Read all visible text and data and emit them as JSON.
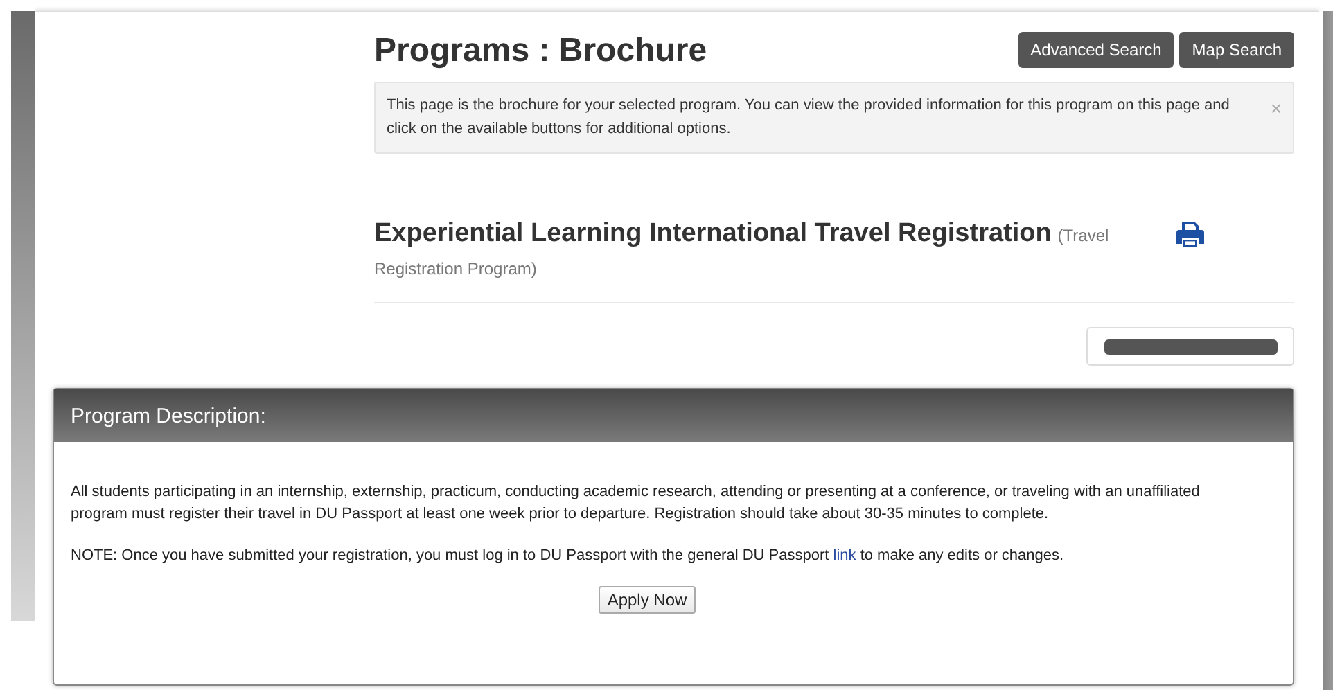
{
  "page": {
    "title": "Programs : Brochure",
    "buttons": [
      "Advanced Search",
      "Map Search"
    ],
    "alert": {
      "text": "This page is the brochure for your selected program. You can view the provided information for this program on this page and click on the available buttons for additional options.",
      "close": "×"
    }
  },
  "program": {
    "name": "Experiential Learning International Travel Registration",
    "type": "(Travel Registration Program)"
  },
  "panel": {
    "title": "Program Description:",
    "paragraph": "All students participating in an internship, externship, practicum, conducting academic research, attending or presenting at a conference, or traveling with an unaffiliated program must register their travel in DU Passport at least one week prior to departure. Registration should take about 30-35 minutes to complete.",
    "note": {
      "before": "NOTE: Once you have submitted your registration, you must log in to DU Passport with the general DU Passport",
      "link": "link",
      "after": "to make any edits or changes."
    },
    "button": "Apply Now"
  }
}
